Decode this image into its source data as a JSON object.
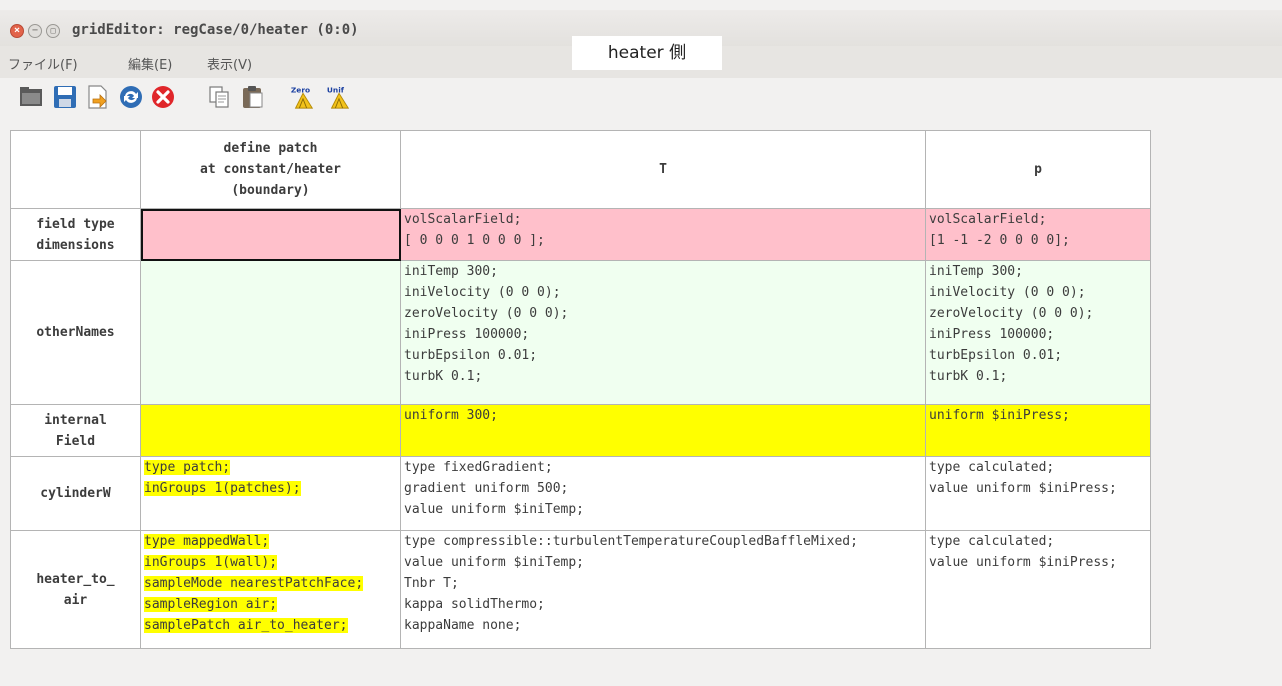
{
  "window": {
    "title": "gridEditor: regCase/0/heater (0:0)",
    "close_glyph": "×",
    "min_glyph": "−",
    "max_glyph": "□"
  },
  "menu": {
    "items": [
      "ファイル(F)",
      "編集(E)",
      "表示(V)"
    ]
  },
  "annotation": "heater 側",
  "toolbar": {
    "icons": [
      "open-folder-icon",
      "save-icon",
      "export-icon",
      "reload-icon",
      "cancel-icon",
      "copy-icon",
      "paste-icon",
      "zero-clear-icon",
      "unif-clear-icon"
    ],
    "zero_label": "Zero",
    "unif_label": "Unif"
  },
  "grid": {
    "columns": [
      "",
      "define patch\nat constant/heater\n(boundary)",
      "T",
      "p"
    ],
    "rows": [
      {
        "header": "field type\ndimensions",
        "cells": [
          "",
          "volScalarField;\n[ 0 0 0 1 0 0 0 ];",
          "volScalarField;\n[1 -1 -2 0 0 0 0];"
        ]
      },
      {
        "header": "otherNames",
        "cells": [
          "",
          "iniTemp 300;\niniVelocity (0 0 0);\nzeroVelocity (0 0 0);\niniPress 100000;\nturbEpsilon 0.01;\nturbK 0.1;",
          "iniTemp 300;\niniVelocity (0 0 0);\nzeroVelocity (0 0 0);\niniPress 100000;\nturbEpsilon 0.01;\nturbK 0.1;"
        ]
      },
      {
        "header": "internal\nField",
        "cells": [
          "",
          "uniform 300;",
          "uniform $iniPress;"
        ]
      },
      {
        "header": "cylinderW",
        "cells": [
          "type patch;\ninGroups 1(patches);",
          "type fixedGradient;\ngradient uniform 500;\nvalue uniform $iniTemp;",
          "type calculated;\nvalue uniform $iniPress;"
        ]
      },
      {
        "header": "heater_to_\nair",
        "cells": [
          "type mappedWall;\ninGroups 1(wall);\nsampleMode nearestPatchFace;\nsampleRegion air;\nsamplePatch air_to_heater;",
          "type compressible::turbulentTemperatureCoupledBaffleMixed;\nvalue uniform $iniTemp;\nTnbr T;\nkappa solidThermo;\nkappaName none;",
          "type calculated;\nvalue uniform $iniPress;"
        ]
      }
    ]
  },
  "colors": {
    "field_row": "#ffc0cb",
    "names_row": "#f0fff0",
    "internal_row": "#ffff00",
    "patch_highlight": "#ffff00"
  }
}
